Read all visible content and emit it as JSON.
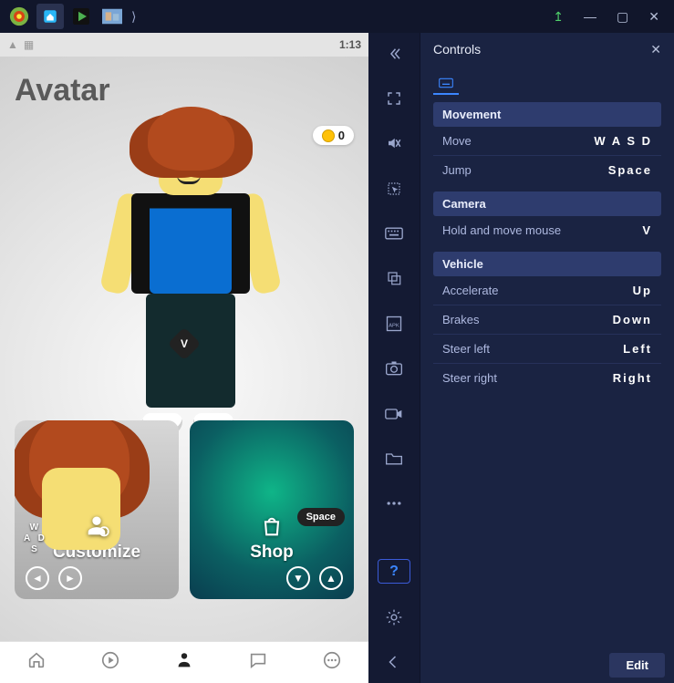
{
  "titlebar": {
    "tabs": [
      {
        "name": "bluestacks-logo"
      },
      {
        "name": "home-tab"
      },
      {
        "name": "play-store-tab"
      },
      {
        "name": "game-tab"
      }
    ]
  },
  "game": {
    "status_clock": "1:13",
    "avatar_title": "Avatar",
    "coin_value": "0",
    "v_label": "V",
    "cards": {
      "customize": {
        "title": "Customize",
        "wasd": {
          "w": "W",
          "a": "A",
          "s": "S",
          "d": "D"
        }
      },
      "shop": {
        "title": "Shop",
        "space_label": "Space"
      }
    }
  },
  "controls_panel": {
    "title": "Controls",
    "edit_label": "Edit",
    "sections": [
      {
        "heading": "Movement",
        "rows": [
          {
            "label": "Move",
            "key": "W A S D"
          },
          {
            "label": "Jump",
            "key": "Space"
          }
        ]
      },
      {
        "heading": "Camera",
        "rows": [
          {
            "label": "Hold and move mouse",
            "key": "V"
          }
        ]
      },
      {
        "heading": "Vehicle",
        "rows": [
          {
            "label": "Accelerate",
            "key": "Up"
          },
          {
            "label": "Brakes",
            "key": "Down"
          },
          {
            "label": "Steer left",
            "key": "Left"
          },
          {
            "label": "Steer right",
            "key": "Right"
          }
        ]
      }
    ]
  }
}
